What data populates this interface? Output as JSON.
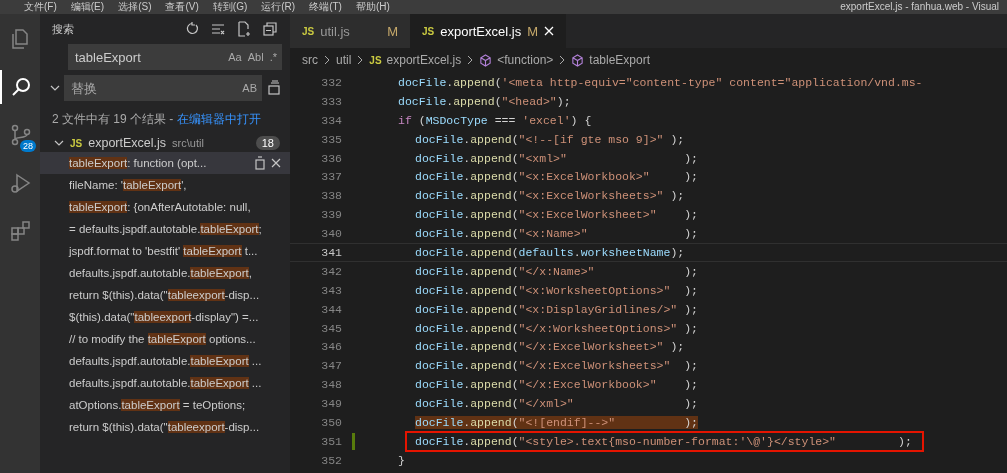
{
  "menu_bar": [
    "文件(F)",
    "编辑(E)",
    "选择(S)",
    "查看(V)",
    "转到(G)",
    "运行(R)",
    "终端(T)",
    "帮助(H)"
  ],
  "window": {
    "title": "exportExcel.js - fanhua.web - Visual"
  },
  "activity_bar": [
    {
      "kind": "files",
      "selected": false
    },
    {
      "kind": "search",
      "selected": true
    },
    {
      "kind": "scm",
      "selected": false,
      "badge": "28"
    },
    {
      "kind": "run",
      "selected": false
    },
    {
      "kind": "extensions",
      "selected": false
    }
  ],
  "sidebar": {
    "title": "搜索",
    "search": {
      "value": "tableExport",
      "toggles": [
        "Aa",
        "Abl",
        ".*"
      ]
    },
    "replace": {
      "placeholder": "替换",
      "toggle": "AB"
    },
    "summary": "2 文件中有 19 个结果 - ",
    "summary_link": "在编辑器中打开",
    "file": {
      "icon_label": "JS",
      "name": "exportExcel.js",
      "path": "src\\util",
      "count": "18",
      "expanded": true
    },
    "results": [
      {
        "selected": true,
        "parts": [
          {
            "text": "tableExport",
            "match": true
          },
          {
            "text": ": function (opt...",
            "match": false
          }
        ]
      },
      {
        "selected": false,
        "parts": [
          {
            "text": "fileName: '",
            "match": false
          },
          {
            "text": "tableExport",
            "match": true
          },
          {
            "text": "',",
            "match": false
          }
        ]
      },
      {
        "selected": false,
        "parts": [
          {
            "text": "tableExport",
            "match": true
          },
          {
            "text": ": {onAfterAutotable: null,",
            "match": false
          }
        ]
      },
      {
        "selected": false,
        "parts": [
          {
            "text": "= defaults.jspdf.autotable.",
            "match": false
          },
          {
            "text": "tableExport",
            "match": true
          },
          {
            "text": ";",
            "match": false
          }
        ]
      },
      {
        "selected": false,
        "parts": [
          {
            "text": "jspdf.format to 'bestfit' ",
            "match": false
          },
          {
            "text": "tableExport",
            "match": true
          },
          {
            "text": " t...",
            "match": false
          }
        ]
      },
      {
        "selected": false,
        "parts": [
          {
            "text": "defaults.jspdf.autotable.",
            "match": false
          },
          {
            "text": "tableExport",
            "match": true
          },
          {
            "text": ",",
            "match": false
          }
        ]
      },
      {
        "selected": false,
        "parts": [
          {
            "text": "return $(this).data(\"",
            "match": false
          },
          {
            "text": "tableexport",
            "match": true
          },
          {
            "text": "-disp...",
            "match": false
          }
        ]
      },
      {
        "selected": false,
        "parts": [
          {
            "text": "$(this).data(\"",
            "match": false
          },
          {
            "text": "tableexport",
            "match": true
          },
          {
            "text": "-display\") =...",
            "match": false
          }
        ]
      },
      {
        "selected": false,
        "parts": [
          {
            "text": "// to modify the ",
            "match": false
          },
          {
            "text": "tableExport",
            "match": true
          },
          {
            "text": " options...",
            "match": false
          }
        ]
      },
      {
        "selected": false,
        "parts": [
          {
            "text": "defaults.jspdf.autotable.",
            "match": false
          },
          {
            "text": "tableExport",
            "match": true
          },
          {
            "text": " ...",
            "match": false
          }
        ]
      },
      {
        "selected": false,
        "parts": [
          {
            "text": "defaults.jspdf.autotable.",
            "match": false
          },
          {
            "text": "tableExport",
            "match": true
          },
          {
            "text": " ...",
            "match": false
          }
        ]
      },
      {
        "selected": false,
        "parts": [
          {
            "text": "atOptions.",
            "match": false
          },
          {
            "text": "tableExport",
            "match": true
          },
          {
            "text": " = teOptions;",
            "match": false
          }
        ]
      },
      {
        "selected": false,
        "parts": [
          {
            "text": "return $(this).data(\"",
            "match": false
          },
          {
            "text": "tableexport",
            "match": true
          },
          {
            "text": "-disp...",
            "match": false
          }
        ]
      }
    ]
  },
  "tabs": [
    {
      "icon_label": "JS",
      "label": "util.js",
      "status": "M",
      "selected": false
    },
    {
      "icon_label": "JS",
      "label": "exportExcel.js",
      "status": "M",
      "selected": true
    }
  ],
  "breadcrumb": [
    {
      "kind": "folder",
      "text": "src"
    },
    {
      "kind": "folder",
      "text": "util"
    },
    {
      "kind": "file",
      "icon_label": "JS",
      "text": "exportExcel.js"
    },
    {
      "kind": "symbol",
      "text": "<function>"
    },
    {
      "kind": "symbol",
      "text": "tableExport"
    }
  ],
  "code": [
    {
      "line": "332",
      "tokens": [
        {
          "text": "docFile",
          "kind": "var"
        },
        {
          "text": ".",
          "kind": "punct"
        },
        {
          "text": "append",
          "kind": "fn"
        },
        {
          "text": "(",
          "kind": "punct"
        },
        {
          "text": "'<meta http-equiv=\"content-type\" content=\"application/vnd.ms-",
          "kind": "str"
        }
      ]
    },
    {
      "line": "333",
      "tokens": [
        {
          "text": "docFile",
          "kind": "var"
        },
        {
          "text": ".",
          "kind": "punct"
        },
        {
          "text": "append",
          "kind": "fn"
        },
        {
          "text": "(",
          "kind": "punct"
        },
        {
          "text": "\"<head>\"",
          "kind": "str"
        },
        {
          "text": ");",
          "kind": "punct"
        }
      ]
    },
    {
      "line": "334",
      "tokens": [
        {
          "text": "if",
          "kind": "kw"
        },
        {
          "text": " (",
          "kind": "punct"
        },
        {
          "text": "MSDocType",
          "kind": "var"
        },
        {
          "text": " === ",
          "kind": "punct"
        },
        {
          "text": "'excel'",
          "kind": "str"
        },
        {
          "text": ") {",
          "kind": "punct"
        }
      ],
      "children": [
        {
          "line": "335",
          "tokens": [
            {
              "text": "docFile",
              "kind": "var"
            },
            {
              "text": ".",
              "kind": "punct"
            },
            {
              "text": "append",
              "kind": "fn"
            },
            {
              "text": "(",
              "kind": "punct"
            },
            {
              "text": "\"<!--[if gte mso 9]>\"",
              "kind": "str"
            },
            {
              "text": " );",
              "kind": "punct"
            }
          ]
        },
        {
          "line": "336",
          "tokens": [
            {
              "text": "docFile",
              "kind": "var"
            },
            {
              "text": ".",
              "kind": "punct"
            },
            {
              "text": "append",
              "kind": "fn"
            },
            {
              "text": "(",
              "kind": "punct"
            },
            {
              "text": "\"<xml>\"",
              "kind": "str"
            },
            {
              "text": "                 );",
              "kind": "punct"
            }
          ]
        },
        {
          "line": "337",
          "tokens": [
            {
              "text": "docFile",
              "kind": "var"
            },
            {
              "text": ".",
              "kind": "punct"
            },
            {
              "text": "append",
              "kind": "fn"
            },
            {
              "text": "(",
              "kind": "punct"
            },
            {
              "text": "\"<x:ExcelWorkbook>\"",
              "kind": "str"
            },
            {
              "text": "     );",
              "kind": "punct"
            }
          ]
        },
        {
          "line": "338",
          "tokens": [
            {
              "text": "docFile",
              "kind": "var"
            },
            {
              "text": ".",
              "kind": "punct"
            },
            {
              "text": "append",
              "kind": "fn"
            },
            {
              "text": "(",
              "kind": "punct"
            },
            {
              "text": "\"<x:ExcelWorksheets>\"",
              "kind": "str"
            },
            {
              "text": " );",
              "kind": "punct"
            }
          ]
        },
        {
          "line": "339",
          "tokens": [
            {
              "text": "docFile",
              "kind": "var"
            },
            {
              "text": ".",
              "kind": "punct"
            },
            {
              "text": "append",
              "kind": "fn"
            },
            {
              "text": "(",
              "kind": "punct"
            },
            {
              "text": "\"<x:ExcelWorksheet>\"",
              "kind": "str"
            },
            {
              "text": "    );",
              "kind": "punct"
            }
          ]
        },
        {
          "line": "340",
          "tokens": [
            {
              "text": "docFile",
              "kind": "var"
            },
            {
              "text": ".",
              "kind": "punct"
            },
            {
              "text": "append",
              "kind": "fn"
            },
            {
              "text": "(",
              "kind": "punct"
            },
            {
              "text": "\"<x:Name>\"",
              "kind": "str"
            },
            {
              "text": "              );",
              "kind": "punct"
            }
          ]
        },
        {
          "line": "341",
          "current": true,
          "tokens": [
            {
              "text": "docFile",
              "kind": "var"
            },
            {
              "text": ".",
              "kind": "punct"
            },
            {
              "text": "append",
              "kind": "fn"
            },
            {
              "text": "(",
              "kind": "punct"
            },
            {
              "text": "defaults",
              "kind": "var"
            },
            {
              "text": ".",
              "kind": "punct"
            },
            {
              "text": "worksheetName",
              "kind": "var"
            },
            {
              "text": ");",
              "kind": "punct"
            }
          ]
        },
        {
          "line": "342",
          "tokens": [
            {
              "text": "docFile",
              "kind": "var"
            },
            {
              "text": ".",
              "kind": "punct"
            },
            {
              "text": "append",
              "kind": "fn"
            },
            {
              "text": "(",
              "kind": "punct"
            },
            {
              "text": "\"</x:Name>\"",
              "kind": "str"
            },
            {
              "text": "             );",
              "kind": "punct"
            }
          ]
        },
        {
          "line": "343",
          "tokens": [
            {
              "text": "docFile",
              "kind": "var"
            },
            {
              "text": ".",
              "kind": "punct"
            },
            {
              "text": "append",
              "kind": "fn"
            },
            {
              "text": "(",
              "kind": "punct"
            },
            {
              "text": "\"<x:WorksheetOptions>\"",
              "kind": "str"
            },
            {
              "text": "  );",
              "kind": "punct"
            }
          ]
        },
        {
          "line": "344",
          "tokens": [
            {
              "text": "docFile",
              "kind": "var"
            },
            {
              "text": ".",
              "kind": "punct"
            },
            {
              "text": "append",
              "kind": "fn"
            },
            {
              "text": "(",
              "kind": "punct"
            },
            {
              "text": "\"<x:DisplayGridlines/>\"",
              "kind": "str"
            },
            {
              "text": " );",
              "kind": "punct"
            }
          ]
        },
        {
          "line": "345",
          "tokens": [
            {
              "text": "docFile",
              "kind": "var"
            },
            {
              "text": ".",
              "kind": "punct"
            },
            {
              "text": "append",
              "kind": "fn"
            },
            {
              "text": "(",
              "kind": "punct"
            },
            {
              "text": "\"</x:WorksheetOptions>\"",
              "kind": "str"
            },
            {
              "text": " );",
              "kind": "punct"
            }
          ]
        },
        {
          "line": "346",
          "tokens": [
            {
              "text": "docFile",
              "kind": "var"
            },
            {
              "text": ".",
              "kind": "punct"
            },
            {
              "text": "append",
              "kind": "fn"
            },
            {
              "text": "(",
              "kind": "punct"
            },
            {
              "text": "\"</x:ExcelWorksheet>\"",
              "kind": "str"
            },
            {
              "text": " );",
              "kind": "punct"
            }
          ]
        },
        {
          "line": "347",
          "tokens": [
            {
              "text": "docFile",
              "kind": "var"
            },
            {
              "text": ".",
              "kind": "punct"
            },
            {
              "text": "append",
              "kind": "fn"
            },
            {
              "text": "(",
              "kind": "punct"
            },
            {
              "text": "\"</x:ExcelWorksheets>\"",
              "kind": "str"
            },
            {
              "text": "  );",
              "kind": "punct"
            }
          ]
        },
        {
          "line": "348",
          "tokens": [
            {
              "text": "docFile",
              "kind": "var"
            },
            {
              "text": ".",
              "kind": "punct"
            },
            {
              "text": "append",
              "kind": "fn"
            },
            {
              "text": "(",
              "kind": "punct"
            },
            {
              "text": "\"</x:ExcelWorkbook>\"",
              "kind": "str"
            },
            {
              "text": "    );",
              "kind": "punct"
            }
          ]
        },
        {
          "line": "349",
          "tokens": [
            {
              "text": "docFile",
              "kind": "var"
            },
            {
              "text": ".",
              "kind": "punct"
            },
            {
              "text": "append",
              "kind": "fn"
            },
            {
              "text": "(",
              "kind": "punct"
            },
            {
              "text": "\"</xml>\"",
              "kind": "str"
            },
            {
              "text": "                );",
              "kind": "punct"
            }
          ]
        },
        {
          "line": "350",
          "highlighted": true,
          "tokens": [
            {
              "text": "docFile",
              "kind": "var"
            },
            {
              "text": ".",
              "kind": "punct"
            },
            {
              "text": "append",
              "kind": "fn"
            },
            {
              "text": "(",
              "kind": "punct"
            },
            {
              "text": "\"<![endif]-->\"",
              "kind": "str"
            },
            {
              "text": "          );",
              "kind": "punct"
            }
          ]
        },
        {
          "line": "351",
          "boxed": true,
          "modified": true,
          "tokens": [
            {
              "text": "docFile",
              "kind": "var"
            },
            {
              "text": ".",
              "kind": "punct"
            },
            {
              "text": "append",
              "kind": "fn"
            },
            {
              "text": "(",
              "kind": "punct"
            },
            {
              "text": "\"<style>.text{mso-number-format:'\\@'}</style>\"",
              "kind": "str"
            },
            {
              "text": "         );",
              "kind": "punct"
            }
          ]
        }
      ]
    },
    {
      "line": "352",
      "tokens": [
        {
          "text": "}",
          "kind": "punct"
        }
      ]
    }
  ]
}
